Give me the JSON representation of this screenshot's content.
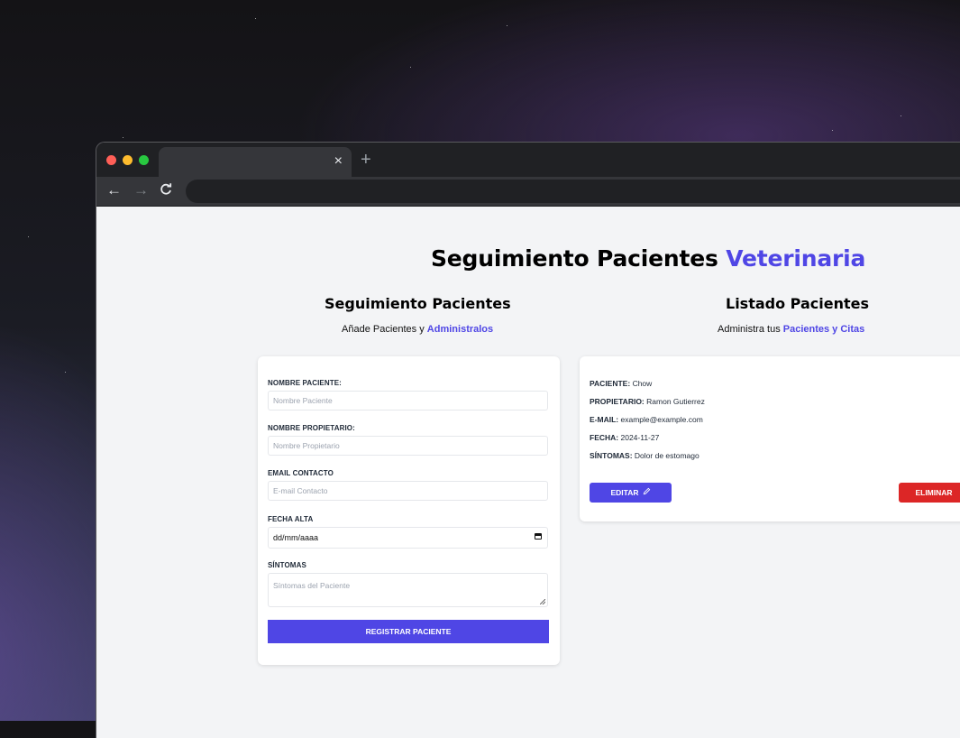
{
  "browser": {
    "tab_close": "×",
    "new_tab": "+",
    "nav_back": "←",
    "nav_forward": "→",
    "nav_reload": "C"
  },
  "page": {
    "title_main": "Seguimiento Pacientes",
    "title_accent": "Veterinaria",
    "accent_color": "#4f46e5"
  },
  "form_section": {
    "title": "Seguimiento Pacientes",
    "subtitle_text": "Añade Pacientes y",
    "subtitle_accent": "Administralos",
    "fields": {
      "pet_name_label": "NOMBRE PACIENTE:",
      "pet_name_placeholder": "Nombre Paciente",
      "owner_label": "NOMBRE PROPIETARIO:",
      "owner_placeholder": "Nombre Propietario",
      "email_label": "EMAIL CONTACTO",
      "email_placeholder": "E-mail Contacto",
      "date_label": "FECHA ALTA",
      "date_value": "dd/mm/aaaa",
      "symptoms_label": "SÍNTOMAS",
      "symptoms_placeholder": "Síntomas del Paciente"
    },
    "submit_label": "REGISTRAR PACIENTE"
  },
  "list_section": {
    "title": "Listado Pacientes",
    "subtitle_text": "Administra tus",
    "subtitle_accent": "Pacientes y Citas",
    "patient": {
      "name_key": "PACIENTE:",
      "name": "Chow",
      "owner_key": "PROPIETARIO:",
      "owner": "Ramon Gutierrez",
      "email_key": "E-MAIL:",
      "email": "example@example.com",
      "date_key": "FECHA:",
      "date": "2024-11-27",
      "symptoms_key": "SÍNTOMAS:",
      "symptoms": "Dolor de estomago"
    },
    "edit_label": "EDITAR",
    "delete_label": "ELIMINAR",
    "delete_color": "#dc2626"
  }
}
